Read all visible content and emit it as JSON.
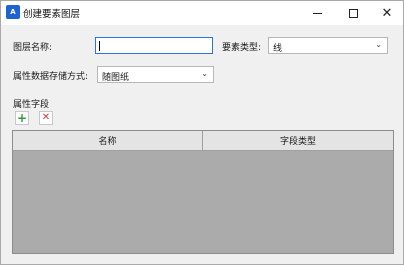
{
  "window": {
    "title": "创建要素图层",
    "icon_label": "A",
    "minimize_icon": "minimize-icon",
    "maximize_icon": "maximize-icon",
    "close_glyph": "✕"
  },
  "form": {
    "layer_name_label": "图层名称:",
    "layer_name_value": "",
    "feature_type_label": "要素类型:",
    "feature_type_value": "线",
    "storage_label": "属性数据存储方式:",
    "storage_value": "随图纸"
  },
  "fields": {
    "section_title": "属性字段",
    "add_glyph": "+",
    "delete_glyph": "✕",
    "columns": [
      "名称",
      "字段类型"
    ]
  },
  "colors": {
    "accent": "#1e63d4",
    "add": "#2e9a3e",
    "delete": "#d23b3b"
  }
}
